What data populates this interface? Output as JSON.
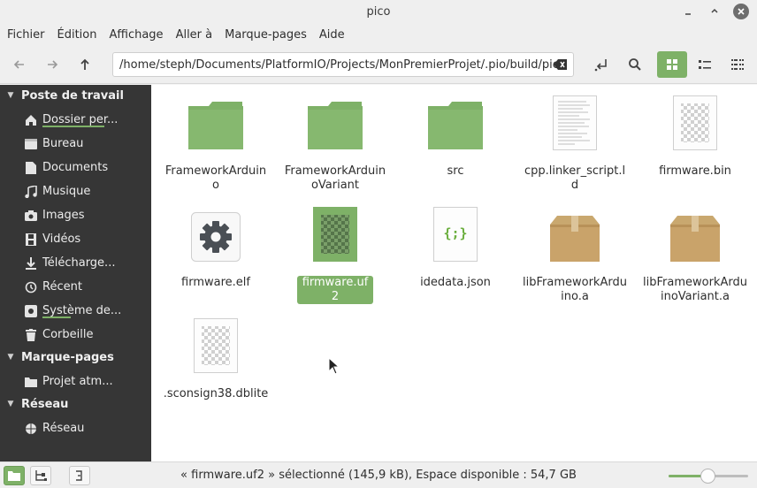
{
  "window": {
    "title": "pico"
  },
  "menu": [
    "Fichier",
    "Édition",
    "Affichage",
    "Aller à",
    "Marque-pages",
    "Aide"
  ],
  "toolbar": {
    "path": "/home/steph/Documents/PlatformIO/Projects/MonPremierProjet/.pio/build/pico",
    "active_view": "icon-view"
  },
  "sidebar": {
    "sections": [
      {
        "title": "Poste de travail",
        "items": [
          {
            "label": "Dossier per...",
            "icon": "home-icon"
          },
          {
            "label": "Bureau",
            "icon": "desktop-icon"
          },
          {
            "label": "Documents",
            "icon": "document-icon"
          },
          {
            "label": "Musique",
            "icon": "music-icon"
          },
          {
            "label": "Images",
            "icon": "camera-icon"
          },
          {
            "label": "Vidéos",
            "icon": "film-icon"
          },
          {
            "label": "Télécharge...",
            "icon": "download-icon"
          },
          {
            "label": "Récent",
            "icon": "history-icon"
          },
          {
            "label": "Système de...",
            "icon": "drive-icon"
          },
          {
            "label": "Corbeille",
            "icon": "trash-icon"
          }
        ]
      },
      {
        "title": "Marque-pages",
        "items": [
          {
            "label": "Projet atm...",
            "icon": "folder-icon"
          }
        ]
      },
      {
        "title": "Réseau",
        "items": [
          {
            "label": "Réseau",
            "icon": "network-icon"
          }
        ]
      }
    ]
  },
  "files": [
    {
      "name": "FrameworkArduino",
      "type": "folder"
    },
    {
      "name": "FrameworkArduinoVariant",
      "type": "folder"
    },
    {
      "name": "src",
      "type": "folder"
    },
    {
      "name": "cpp.linker_script.ld",
      "type": "text"
    },
    {
      "name": "firmware.bin",
      "type": "binary"
    },
    {
      "name": "firmware.elf",
      "type": "executable"
    },
    {
      "name": "firmware.uf2",
      "type": "binary",
      "selected": true
    },
    {
      "name": "idedata.json",
      "type": "json"
    },
    {
      "name": "libFrameworkArduino.a",
      "type": "archive"
    },
    {
      "name": "libFrameworkArduinoVariant.a",
      "type": "archive"
    },
    {
      "name": ".sconsign38.dblite",
      "type": "binary"
    }
  ],
  "status": {
    "text": "« firmware.uf2 » sélectionné (145,9 kB), Espace disponible : 54,7 GB",
    "zoom_fraction": 0.5
  },
  "colors": {
    "accent": "#7eb167",
    "sidebar_bg": "#363636",
    "folder": "#7eb167"
  }
}
